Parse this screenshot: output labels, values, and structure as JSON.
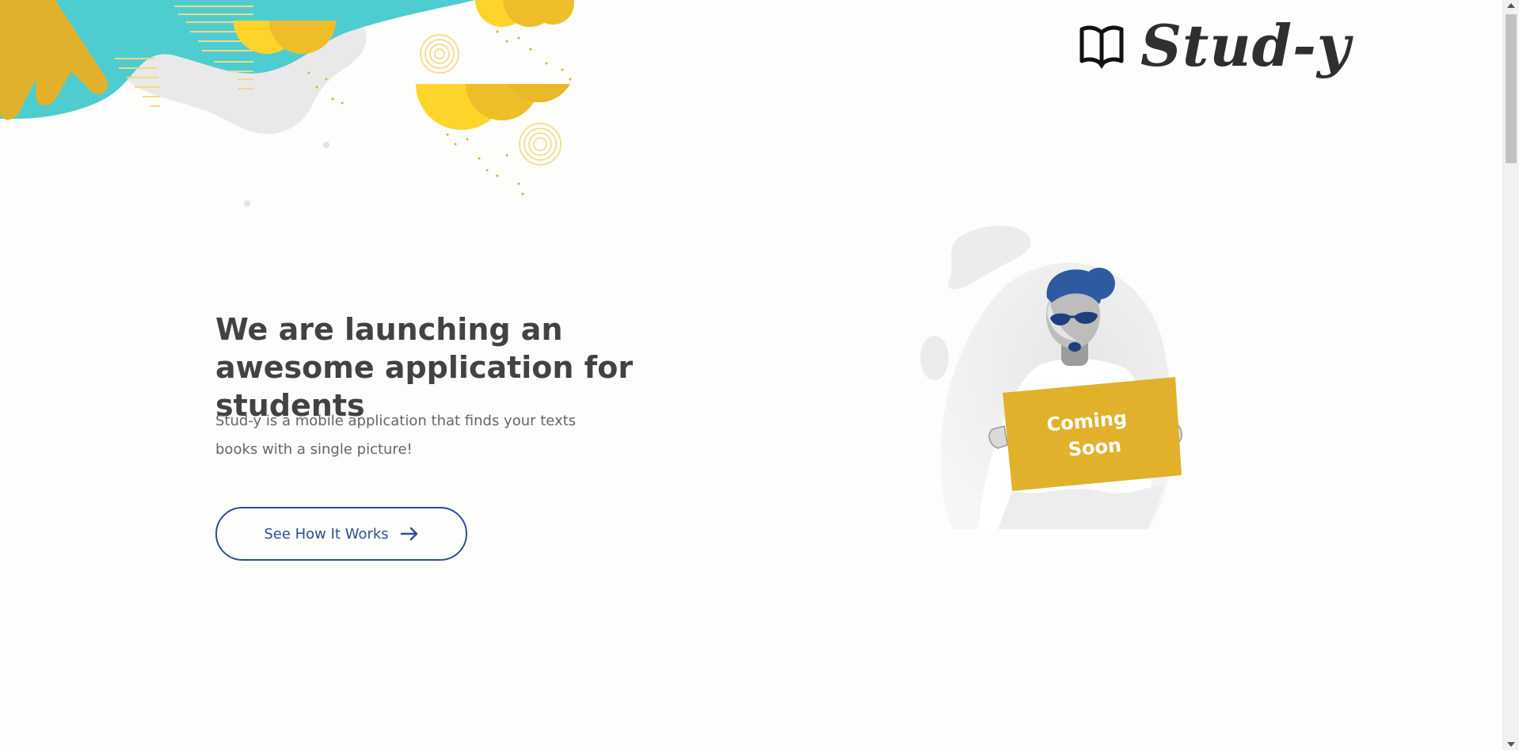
{
  "brand": {
    "logo_text": "Stud-y",
    "logo_icon": "open-book-icon"
  },
  "hero": {
    "title": "We are launching an awesome application for students",
    "description": "Stud-y is a mobile application that finds your texts books with a single picture!",
    "cta_label": "See How It Works",
    "cta_icon": "arrow-right-icon"
  },
  "illustration": {
    "sign_line1": "Coming",
    "sign_line2": "Soon"
  },
  "colors": {
    "accent_blue": "#2d4f95",
    "teal": "#4ecdd0",
    "yellow": "#ffd42a",
    "mustard": "#e1b12c",
    "heading": "#424242",
    "body_text": "#666666"
  }
}
